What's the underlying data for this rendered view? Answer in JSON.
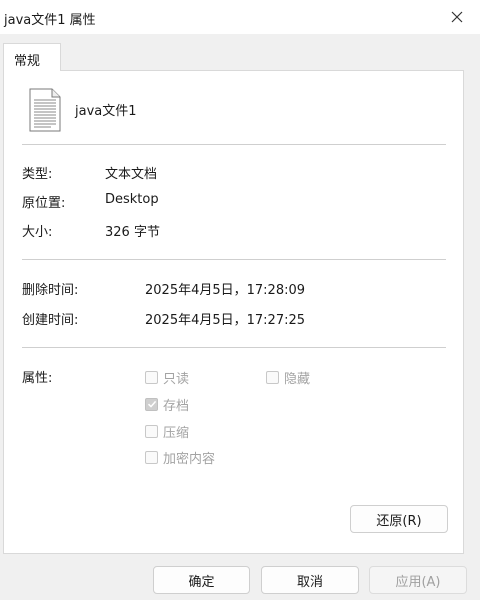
{
  "window": {
    "title": "java文件1 属性"
  },
  "tabs": [
    {
      "label": "常规"
    }
  ],
  "file": {
    "name": "java文件1",
    "icon": "text-document-icon"
  },
  "info": {
    "type_label": "类型:",
    "type_value": "文本文档",
    "location_label": "原位置:",
    "location_value": "Desktop",
    "size_label": "大小:",
    "size_value": "326 字节"
  },
  "times": {
    "deleted_label": "删除时间:",
    "deleted_value": "2025年4月5日，17:28:09",
    "created_label": "创建时间:",
    "created_value": "2025年4月5日，17:27:25"
  },
  "attributes": {
    "label": "属性:",
    "readonly": {
      "label": "只读",
      "checked": false
    },
    "hidden": {
      "label": "隐藏",
      "checked": false
    },
    "archive": {
      "label": "存档",
      "checked": true
    },
    "compress": {
      "label": "压缩",
      "checked": false
    },
    "encrypt": {
      "label": "加密内容",
      "checked": false
    }
  },
  "buttons": {
    "restore": "还原(R)",
    "ok": "确定",
    "cancel": "取消",
    "apply": "应用(A)"
  }
}
